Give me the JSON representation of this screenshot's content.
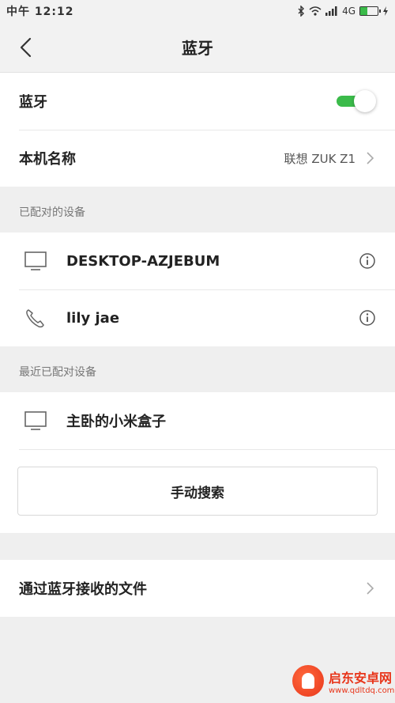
{
  "status_bar": {
    "time": "中午 12:12",
    "network": "4G",
    "battery_level": 0.4
  },
  "header": {
    "title": "蓝牙",
    "back_icon": "chevron-left-icon"
  },
  "settings": {
    "bluetooth_label": "蓝牙",
    "bluetooth_on": true,
    "device_name_label": "本机名称",
    "device_name_value": "联想 ZUK Z1"
  },
  "paired": {
    "section_title": "已配对的设备",
    "devices": [
      {
        "name": "DESKTOP-AZJEBUM",
        "icon": "monitor-icon"
      },
      {
        "name": "lily jae",
        "icon": "phone-icon"
      }
    ]
  },
  "recent": {
    "section_title": "最近已配对设备",
    "devices": [
      {
        "name": "主卧的小米盒子",
        "icon": "monitor-icon"
      }
    ]
  },
  "search_button_label": "手动搜索",
  "received_files_label": "通过蓝牙接收的文件",
  "watermark": {
    "name": "启东安卓网",
    "url": "www.qdltdq.com"
  },
  "colors": {
    "accent": "#3bbb4a",
    "background": "#efefef",
    "watermark": "#e8351a"
  }
}
